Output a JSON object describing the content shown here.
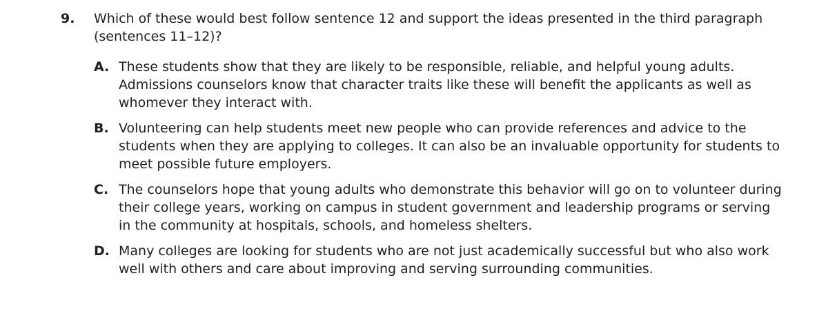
{
  "question": {
    "number": "9.",
    "stem": "Which of these would best follow sentence 12 and support the ideas presented in the third paragraph (sentences 11–12)?",
    "choices": [
      {
        "letter": "A.",
        "text": "These students show that they are likely to be responsible, reliable, and helpful young adults. Admissions counselors know that character traits like these will benefit the applicants as well as whomever they interact with."
      },
      {
        "letter": "B.",
        "text": "Volunteering can help students meet new people who can provide references and advice to the students when they are applying to colleges. It can also be an invaluable opportunity for students to meet possible future employers."
      },
      {
        "letter": "C.",
        "text": "The counselors hope that young adults who demonstrate this behavior will go on to volunteer during their college years, working on campus in student government and leadership programs or serving in the community at hospitals, schools, and homeless shelters."
      },
      {
        "letter": "D.",
        "text": "Many colleges are looking for students who are not just academically successful but who also work well with others and care about improving and serving surrounding communities."
      }
    ]
  }
}
